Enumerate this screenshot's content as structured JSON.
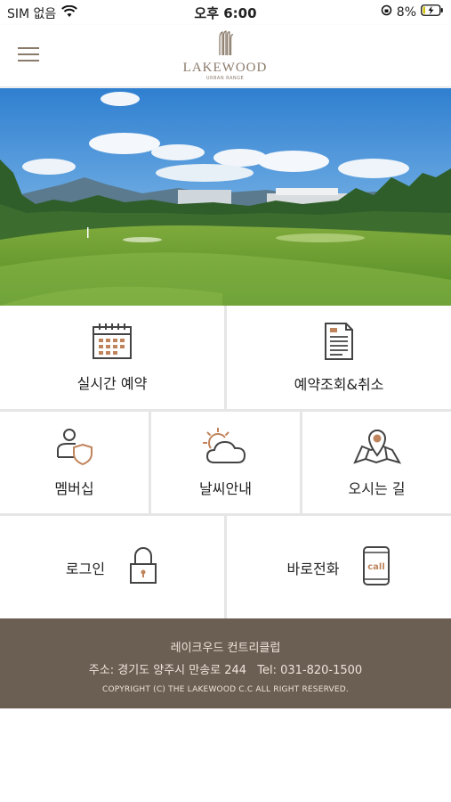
{
  "status_bar": {
    "carrier": "SIM 없음",
    "time": "오후 6:00",
    "battery": "8%",
    "icons": [
      "wifi-icon",
      "orientation-lock-icon",
      "battery-charging-icon"
    ]
  },
  "header": {
    "menu_icon": "hamburger-menu-icon",
    "logo_name": "LAKEWOOD",
    "logo_sub": "URBAN RANGE"
  },
  "hero": {
    "image": "golf-course-photo"
  },
  "menu": [
    {
      "label": "실시간 예약",
      "icon": "calendar-icon"
    },
    {
      "label": "예약조회&취소",
      "icon": "document-icon"
    },
    {
      "label": "멤버십",
      "icon": "member-shield-icon"
    },
    {
      "label": "날씨안내",
      "icon": "weather-sun-cloud-icon"
    },
    {
      "label": "오시는 길",
      "icon": "map-pin-icon"
    },
    {
      "label": "로그인",
      "icon": "lock-icon"
    },
    {
      "label": "바로전화",
      "icon": "phone-call-icon"
    }
  ],
  "footer": {
    "name": "레이크우드 컨트리클럽",
    "address": "주소: 경기도 양주시 만송로 244",
    "tel": "Tel: 031-820-1500",
    "copyright": "COPYRIGHT (C) THE LAKEWOOD C.C ALL RIGHT RESERVED."
  },
  "colors": {
    "accent": "#c0845c",
    "footer_bg": "#6b5e52",
    "logo": "#8a7a6a"
  }
}
